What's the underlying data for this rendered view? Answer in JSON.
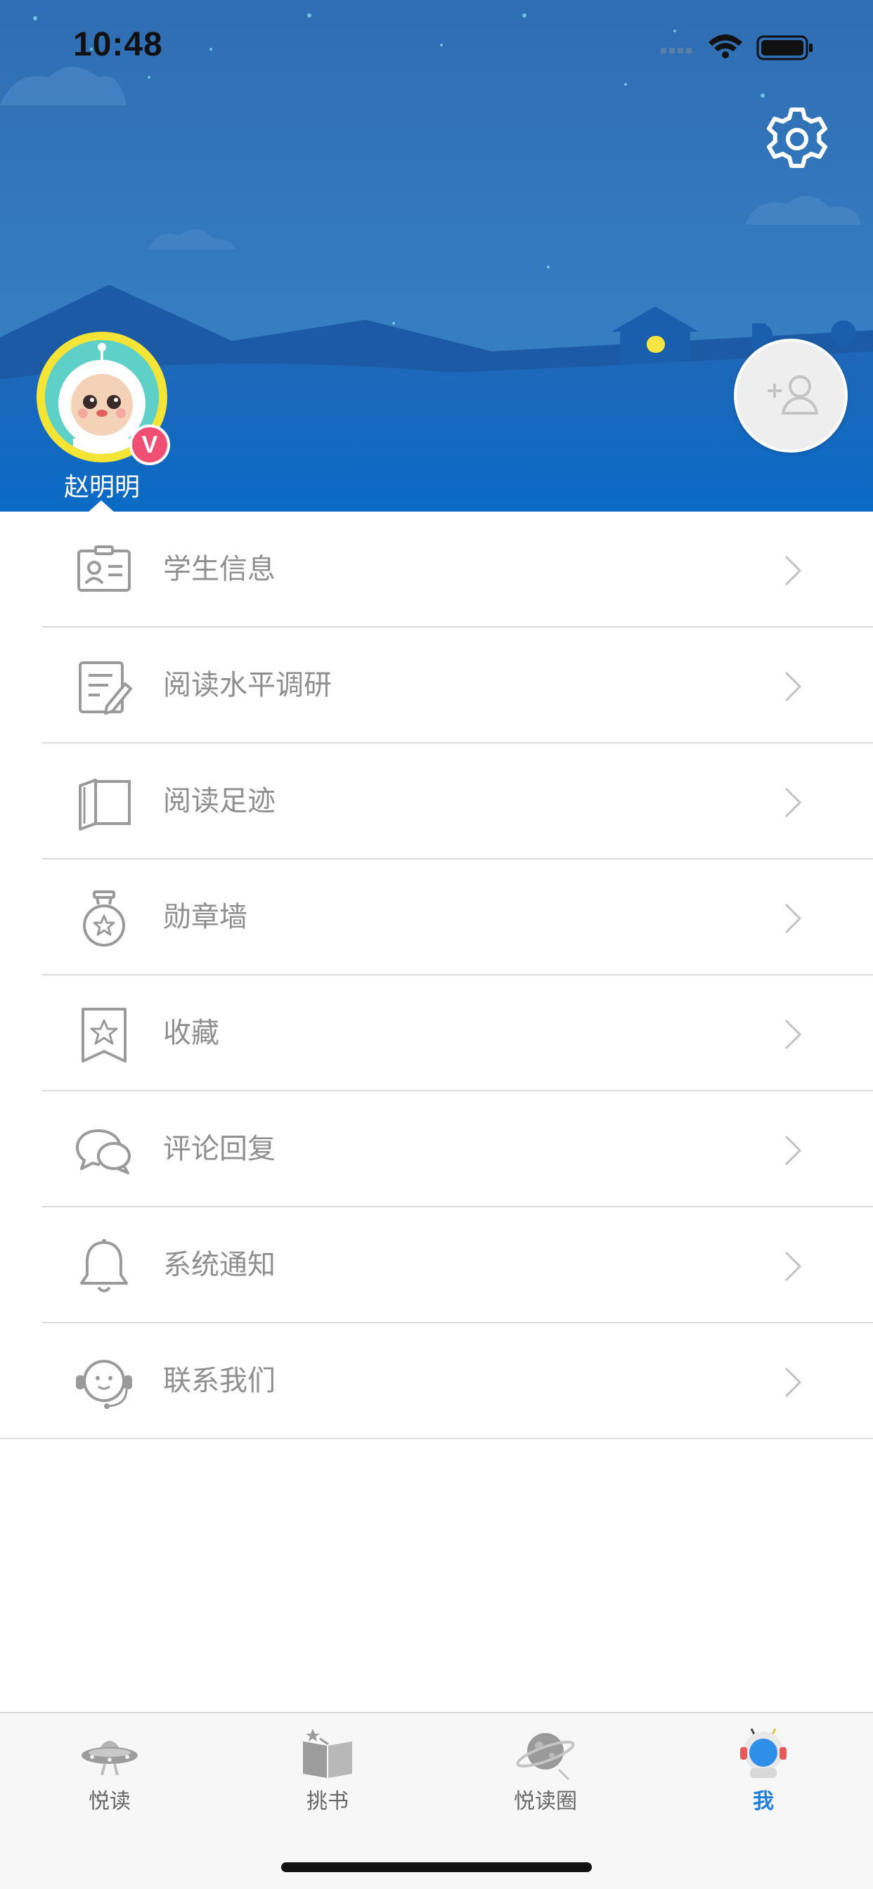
{
  "status_bar": {
    "time": "10:48"
  },
  "profile": {
    "name": "赵明明",
    "badge": "V"
  },
  "menu": [
    {
      "label": "学生信息",
      "icon": "id-card-icon"
    },
    {
      "label": "阅读水平调研",
      "icon": "survey-edit-icon"
    },
    {
      "label": "阅读足迹",
      "icon": "open-book-icon"
    },
    {
      "label": "勋章墙",
      "icon": "medal-icon"
    },
    {
      "label": "收藏",
      "icon": "bookmark-star-icon"
    },
    {
      "label": "评论回复",
      "icon": "chat-bubbles-icon"
    },
    {
      "label": "系统通知",
      "icon": "bell-icon"
    },
    {
      "label": "联系我们",
      "icon": "headset-icon"
    }
  ],
  "tabs": [
    {
      "label": "悦读",
      "icon": "ufo-icon",
      "active": false
    },
    {
      "label": "挑书",
      "icon": "book-pick-icon",
      "active": false
    },
    {
      "label": "悦读圈",
      "icon": "planet-icon",
      "active": false
    },
    {
      "label": "我",
      "icon": "astronaut-icon",
      "active": true
    }
  ],
  "colors": {
    "header_blue": "#2f6fb5",
    "active_tab": "#1f7fe0",
    "text_gray": "#8f8f8f",
    "badge_red": "#ee4f73"
  }
}
